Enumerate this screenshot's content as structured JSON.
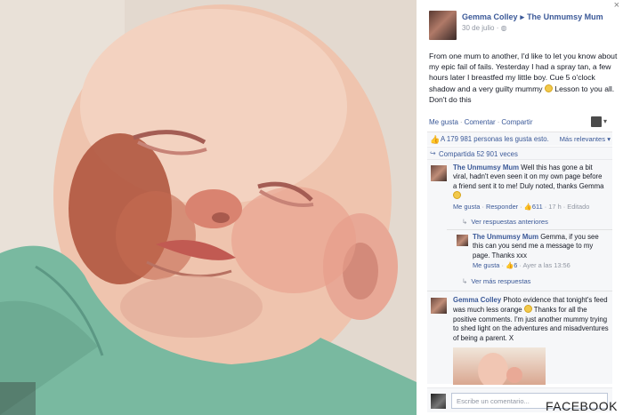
{
  "post": {
    "author": "Gemma Colley",
    "target_page": "The Unmumsy Mum",
    "date": "30 de julio",
    "date_icon": "globe-icon",
    "text": "From one mum to another, I'd like to let you know about my epic fail of fails. Yesterday I had a spray tan, a few hours later I breastfed my little boy. Cue 5 o'clock shadow and a very guilty mummy",
    "text_tail": " Lesson to you all. Don't do this"
  },
  "actions": {
    "like": "Me gusta",
    "comment": "Comentar",
    "share": "Compartir",
    "separator": "·"
  },
  "stats": {
    "likes": "A 179 981 personas les gusta esto.",
    "sort": "Más relevantes",
    "shares": "Compartida 52 901 veces"
  },
  "comments": [
    {
      "author": "The Unmumsy Mum",
      "text": " Well this has gone a bit viral, hadn't even seen it on my own page before a friend sent it to me! Duly noted, thanks Gemma",
      "like": "Me gusta",
      "reply": "Responder",
      "count": "611",
      "time": "17 h",
      "edited": "Editado",
      "view_previous": "Ver respuestas anteriores",
      "replies": [
        {
          "author": "The Unmumsy Mum",
          "text": " Gemma, if you see this can you send me a message to my page. Thanks xxx",
          "like": "Me gusta",
          "count": "6",
          "time": "Ayer a las 13:56"
        }
      ],
      "view_more": "Ver más respuestas"
    },
    {
      "author": "Gemma Colley",
      "text_a": " Photo evidence that tonight's feed was much less orange",
      "text_b": " Thanks for all the positive comments. I'm just another mummy trying to shed light on the adventures and misadventures of being a parent. X"
    }
  ],
  "composer": {
    "placeholder": "Escribe un comentario..."
  },
  "watermark": "FACEBOOK",
  "close": "×",
  "colors": {
    "link": "#3b5998",
    "meta": "#9197a3",
    "panel_bg": "#f6f7f9"
  }
}
